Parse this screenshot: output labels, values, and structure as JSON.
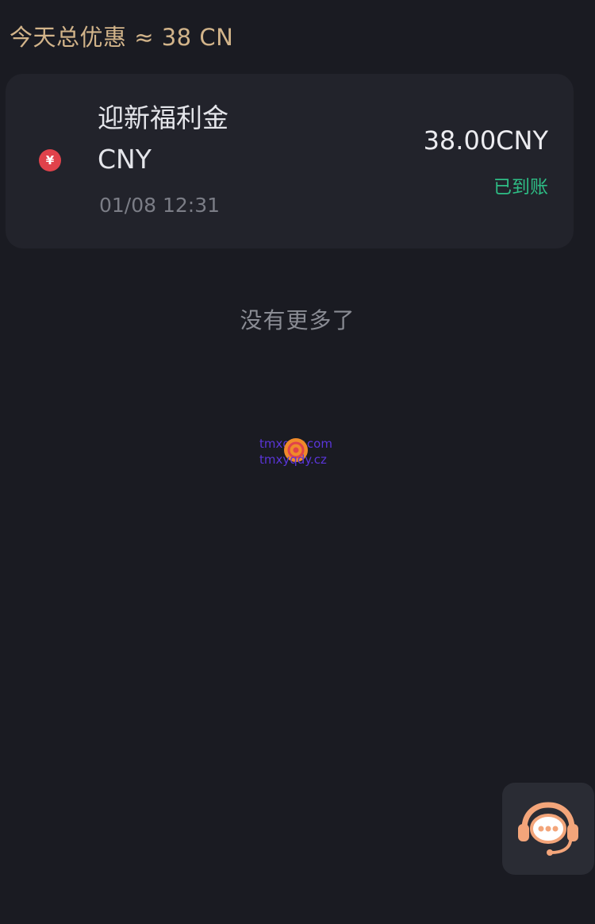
{
  "summary": {
    "text": "今天总优惠 ≈ 38 CN"
  },
  "record": {
    "icon": "yuan-coin-icon",
    "icon_glyph": "¥",
    "title": "迎新福利金",
    "currency": "CNY",
    "time": "01/08 12:31",
    "amount": "38.00CNY",
    "status": "已到账",
    "status_color": "#2ebd85",
    "icon_color": "#e0424b"
  },
  "list_end": {
    "text": "没有更多了"
  },
  "watermark": {
    "line1": "tmxqdy.com",
    "line2": "tmxyqdy.cz"
  },
  "support": {
    "icon": "customer-service-icon"
  }
}
